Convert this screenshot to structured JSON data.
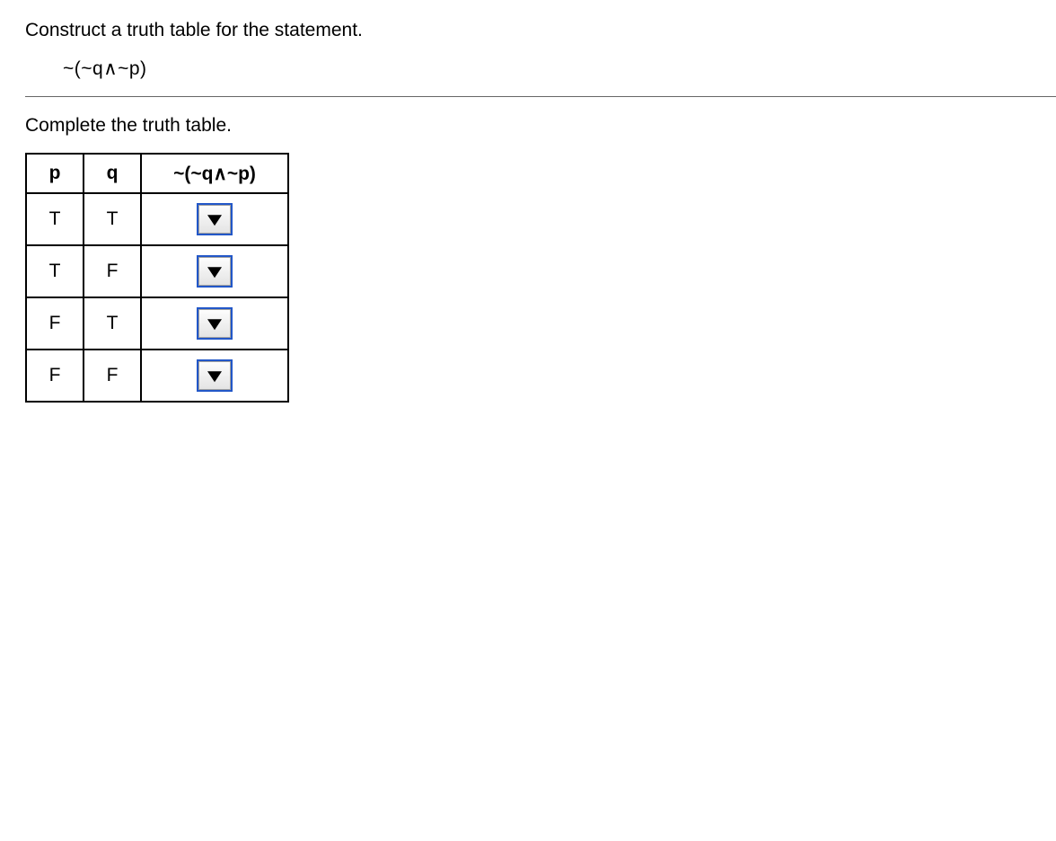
{
  "prompt": "Construct a truth table for the statement.",
  "expression": "~(~q∧~p)",
  "complete": "Complete the truth table.",
  "headers": {
    "p": "p",
    "q": "q",
    "expr": "~(~q∧~p)"
  },
  "rows": [
    {
      "p": "T",
      "q": "T"
    },
    {
      "p": "T",
      "q": "F"
    },
    {
      "p": "F",
      "q": "T"
    },
    {
      "p": "F",
      "q": "F"
    }
  ]
}
